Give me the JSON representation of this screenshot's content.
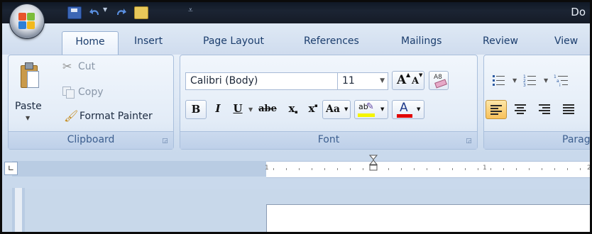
{
  "window": {
    "title": "Do"
  },
  "tabs": [
    {
      "label": "Home"
    },
    {
      "label": "Insert"
    },
    {
      "label": "Page Layout"
    },
    {
      "label": "References"
    },
    {
      "label": "Mailings"
    },
    {
      "label": "Review"
    },
    {
      "label": "View"
    }
  ],
  "clipboard": {
    "paste_label": "Paste",
    "cut_label": "Cut",
    "copy_label": "Copy",
    "format_painter_label": "Format Painter",
    "group_label": "Clipboard"
  },
  "font": {
    "font_name": "Calibri (Body)",
    "font_size": "11",
    "group_label": "Font",
    "grow_glyph": "A",
    "shrink_glyph": "A",
    "bold_glyph": "B",
    "italic_glyph": "I",
    "underline_glyph": "U",
    "strike_glyph": "abe",
    "subscript_glyph": "x",
    "superscript_glyph": "x",
    "case_glyph": "Aa",
    "highlight_glyph": "ab",
    "font_color_glyph": "A",
    "highlight_color": "#f5f500",
    "font_color": "#e00000"
  },
  "paragraph": {
    "group_label": "Parag"
  },
  "ruler": {
    "left_number": "1",
    "right_number": "1",
    "right_number_2": "2"
  },
  "icons": {
    "office": "office-logo-icon",
    "save": "save-icon",
    "undo": "undo-icon",
    "redo": "redo-icon",
    "paste": "paste-icon",
    "cut": "scissors-icon",
    "copy": "copy-icon",
    "format_painter": "brush-icon",
    "clear_format": "eraser-icon",
    "bullets": "bullets-icon",
    "numbering": "numbering-icon",
    "multilevel": "multilevel-list-icon",
    "align_left": "align-left-icon",
    "center": "align-center-icon",
    "align_right": "align-right-icon",
    "justify": "justify-icon"
  }
}
